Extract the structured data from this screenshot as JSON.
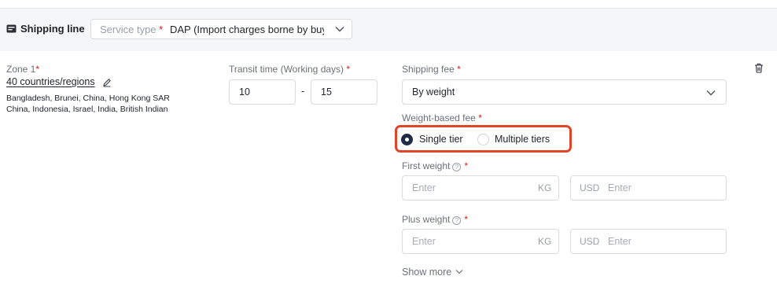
{
  "header": {
    "section_title": "Shipping line",
    "icon": "shipping-line-icon",
    "service_type": {
      "label": "Service type",
      "required_mark": "*",
      "value": "DAP  (Import charges borne by buy",
      "icon": "chevron-down-icon"
    }
  },
  "zone": {
    "label": "Zone 1",
    "required_mark": "*",
    "count_link": "40 countries/regions",
    "edit_icon": "pencil-icon",
    "countries_line1": "Bangladesh, Brunei, China, Hong Kong SAR",
    "countries_line2": "China, Indonesia, Israel, India, British Indian"
  },
  "transit": {
    "label": "Transit time (Working days)",
    "required_mark": "*",
    "min": "10",
    "separator": "-",
    "max": "15"
  },
  "shipping_fee": {
    "label": "Shipping fee",
    "required_mark": "*",
    "value": "By weight",
    "icon": "chevron-down-icon"
  },
  "weight_based_fee": {
    "label": "Weight-based fee",
    "required_mark": "*",
    "options": [
      {
        "label": "Single tier",
        "selected": true
      },
      {
        "label": "Multiple tiers",
        "selected": false
      }
    ],
    "highlight_color": "#e0452a"
  },
  "first_weight": {
    "label": "First weight",
    "help_icon": "question-circle-icon",
    "help_glyph": "?",
    "required_mark": "*",
    "weight_placeholder": "Enter",
    "weight_unit": "KG",
    "currency": "USD",
    "price_placeholder": "Enter"
  },
  "plus_weight": {
    "label": "Plus weight",
    "help_icon": "question-circle-icon",
    "help_glyph": "?",
    "required_mark": "*",
    "weight_placeholder": "Enter",
    "weight_unit": "KG",
    "currency": "USD",
    "price_placeholder": "Enter"
  },
  "show_more": {
    "label": "Show more",
    "icon": "chevron-down-icon"
  },
  "actions": {
    "delete_icon": "trash-icon"
  },
  "colors": {
    "required": "#d0221a",
    "radio_selected": "#1f2a44",
    "header_background": "#f5f6f7"
  }
}
